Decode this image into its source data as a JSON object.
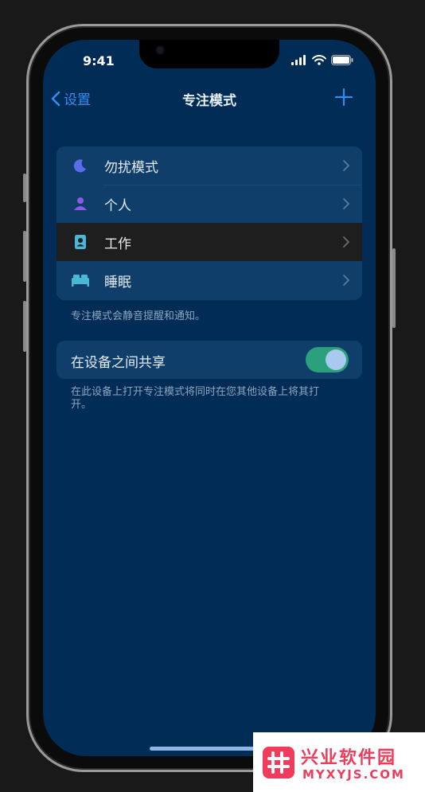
{
  "status": {
    "time": "9:41"
  },
  "nav": {
    "back_label": "设置",
    "title": "专注模式"
  },
  "modes": [
    {
      "label": "勿扰模式",
      "icon": "moon-icon"
    },
    {
      "label": "个人",
      "icon": "person-icon"
    },
    {
      "label": "工作",
      "icon": "id-badge-icon"
    },
    {
      "label": "睡眠",
      "icon": "bed-icon"
    }
  ],
  "modes_footnote": "专注模式会静音提醒和通知。",
  "share": {
    "label": "在设备之间共享",
    "enabled": true,
    "footnote": "在此设备上打开专注模式将同时在您其他设备上将其打开。"
  },
  "watermark": {
    "title": "兴业软件园",
    "subtitle": "MYXYJS.COM"
  },
  "colors": {
    "background": "#002c55",
    "accent": "#3a8bf0",
    "toggle_on": "#2aa07c",
    "selected_row": "#1e1e1e"
  }
}
